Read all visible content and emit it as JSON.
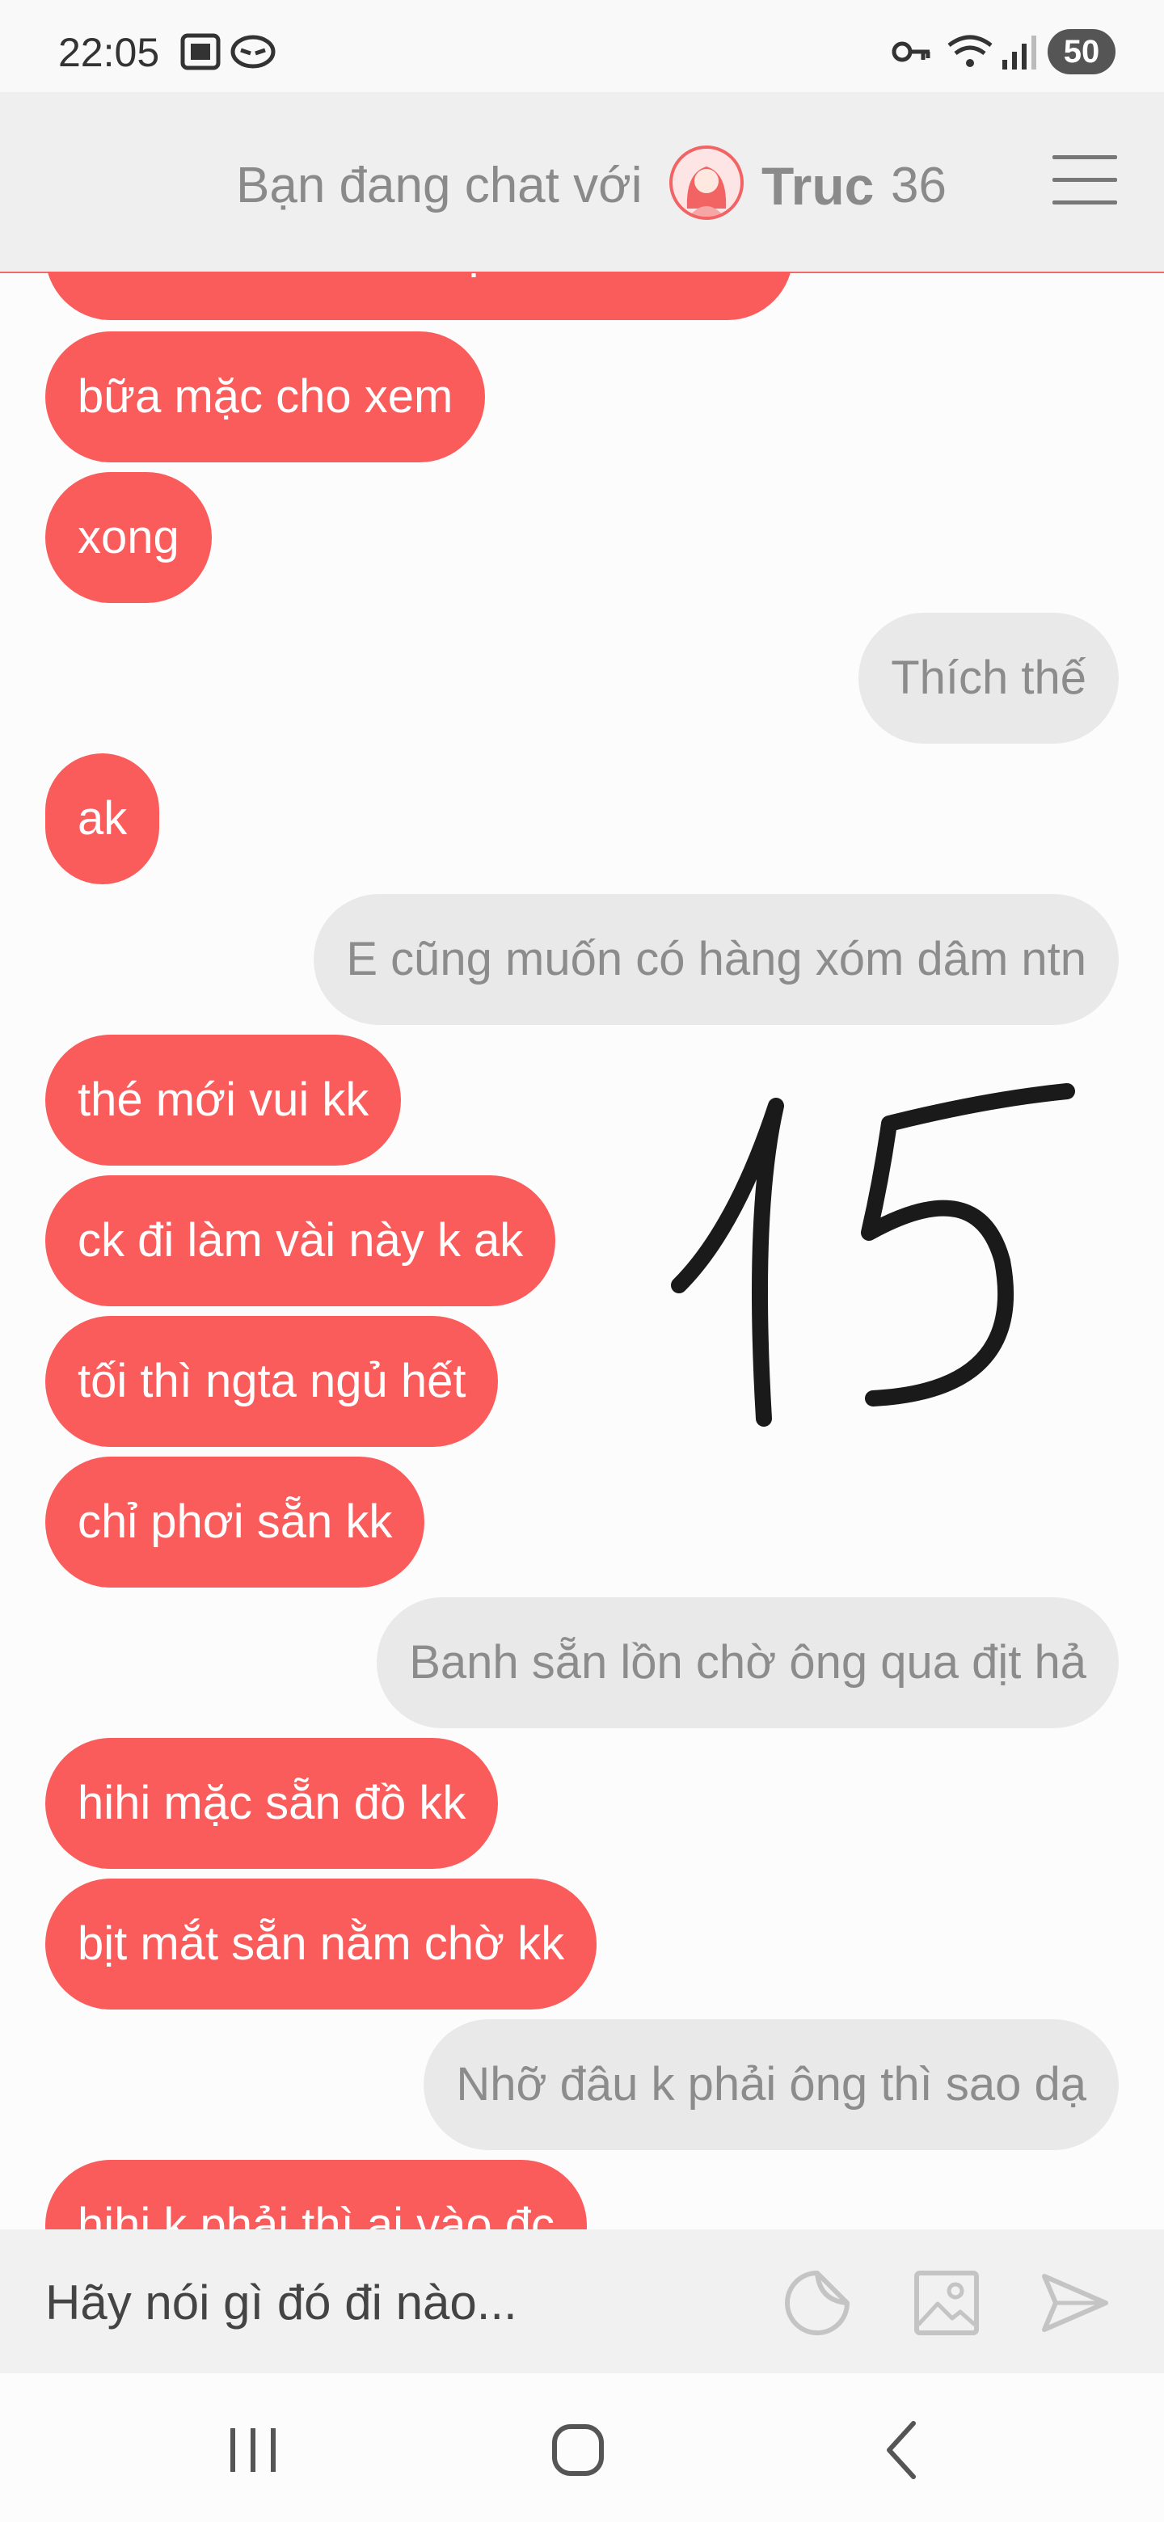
{
  "status_bar": {
    "time": "22:05",
    "battery": "50"
  },
  "header": {
    "prefix": "Bạn đang chat với",
    "name": "Truc",
    "age": "36"
  },
  "messages": [
    {
      "side": "recv",
      "text": "thì bảo bữa nào mặc cho xem kk"
    },
    {
      "side": "recv",
      "text": "bữa mặc cho xem"
    },
    {
      "side": "recv",
      "text": "xong"
    },
    {
      "side": "sent",
      "text": "Thích thế"
    },
    {
      "side": "recv",
      "text": "ak"
    },
    {
      "side": "sent",
      "text": "E cũng muốn có hàng xóm dâm ntn"
    },
    {
      "side": "recv",
      "text": "thé mới vui kk"
    },
    {
      "side": "recv",
      "text": "ck đi làm vài này k ak"
    },
    {
      "side": "recv",
      "text": "tối thì ngta ngủ hết"
    },
    {
      "side": "recv",
      "text": "chỉ phơi sẵn kk"
    },
    {
      "side": "sent",
      "text": "Banh sẵn lồn chờ ông qua địt hả"
    },
    {
      "side": "recv",
      "text": "hihi mặc sẵn đồ kk"
    },
    {
      "side": "recv",
      "text": "bịt mắt sẵn nằm chờ kk"
    },
    {
      "side": "sent",
      "text": "Nhỡ đâu k phải ông thì sao dạ"
    },
    {
      "side": "recv",
      "text": "hihi k phải thì ai vào đc"
    }
  ],
  "annotation": {
    "text": "15"
  },
  "input": {
    "placeholder": "Hãy nói gì đó đi nào..."
  },
  "icons": {
    "status": [
      "screenshot-icon",
      "chat-head-icon",
      "key-icon",
      "wifi-icon",
      "signal-icon"
    ],
    "input": [
      "sticker-icon",
      "image-icon",
      "send-icon"
    ],
    "nav": [
      "recent-apps-icon",
      "home-icon",
      "back-icon"
    ]
  },
  "colors": {
    "received_bubble": "#fa5b5b",
    "sent_bubble": "#e9e9e9",
    "accent": "#f26464"
  }
}
